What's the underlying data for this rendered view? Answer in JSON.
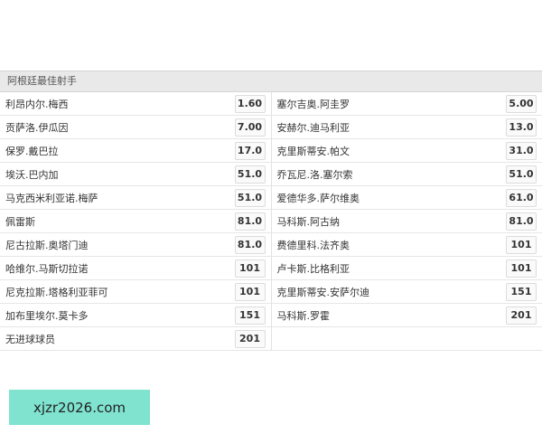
{
  "header": {
    "title": "阿根廷最佳射手"
  },
  "left": [
    {
      "name": "利昂内尔.梅西",
      "odds": "1.60"
    },
    {
      "name": "贡萨洛.伊瓜因",
      "odds": "7.00"
    },
    {
      "name": "保罗.戴巴拉",
      "odds": "17.0"
    },
    {
      "name": "埃沃.巴内加",
      "odds": "51.0"
    },
    {
      "name": "马克西米利亚诺.梅萨",
      "odds": "51.0"
    },
    {
      "name": "佩雷斯",
      "odds": "81.0"
    },
    {
      "name": "尼古拉斯.奥塔门迪",
      "odds": "81.0"
    },
    {
      "name": "哈维尔.马斯切拉诺",
      "odds": "101"
    },
    {
      "name": "尼克拉斯.塔格利亚菲可",
      "odds": "101"
    },
    {
      "name": "加布里埃尔.莫卡多",
      "odds": "151"
    },
    {
      "name": "无进球球员",
      "odds": "201"
    }
  ],
  "right": [
    {
      "name": "塞尔吉奥.阿圭罗",
      "odds": "5.00"
    },
    {
      "name": "安赫尔.迪马利亚",
      "odds": "13.0"
    },
    {
      "name": "克里斯蒂安.帕文",
      "odds": "31.0"
    },
    {
      "name": "乔瓦尼.洛.塞尔索",
      "odds": "51.0"
    },
    {
      "name": "爱德华多.萨尔维奥",
      "odds": "61.0"
    },
    {
      "name": "马科斯.阿古纳",
      "odds": "81.0"
    },
    {
      "name": "费德里科.法齐奥",
      "odds": "101"
    },
    {
      "name": "卢卡斯.比格利亚",
      "odds": "101"
    },
    {
      "name": "克里斯蒂安.安萨尔迪",
      "odds": "151"
    },
    {
      "name": "马科斯.罗霍",
      "odds": "201"
    }
  ],
  "watermark": {
    "text": "xjzr2026.com"
  }
}
